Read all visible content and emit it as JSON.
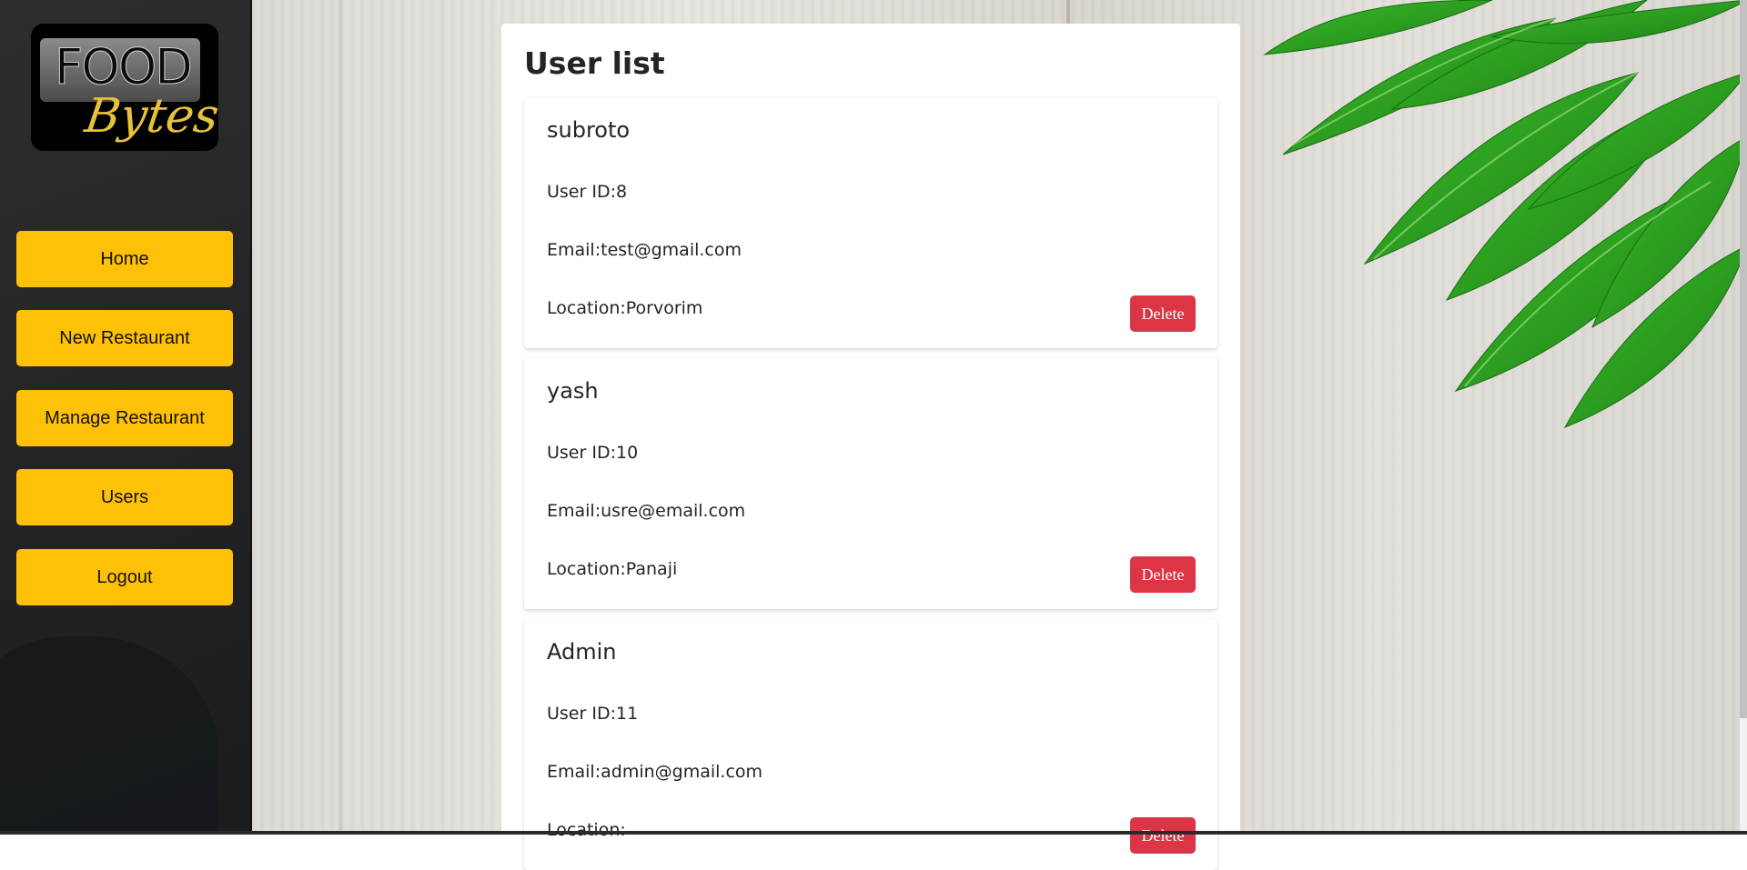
{
  "logo": {
    "line1": "FOOD",
    "line2": "Bytes"
  },
  "nav": [
    {
      "label": "Home"
    },
    {
      "label": "New Restaurant"
    },
    {
      "label": "Manage Restaurant"
    },
    {
      "label": "Users"
    },
    {
      "label": "Logout"
    }
  ],
  "main": {
    "title": "User list",
    "users": [
      {
        "name": "subroto",
        "id_text": "User ID:8",
        "email_text": "Email:test@gmail.com",
        "location_text": "Location:Porvorim",
        "delete_label": "Delete"
      },
      {
        "name": "yash",
        "id_text": "User ID:10",
        "email_text": "Email:usre@email.com",
        "location_text": "Location:Panaji",
        "delete_label": "Delete"
      },
      {
        "name": "Admin",
        "id_text": "User ID:11",
        "email_text": "Email:admin@gmail.com",
        "location_text": "Location:",
        "delete_label": "Delete"
      }
    ]
  },
  "colors": {
    "nav_button": "#ffc107",
    "delete_button": "#dc3545",
    "sidebar": "#232325"
  }
}
